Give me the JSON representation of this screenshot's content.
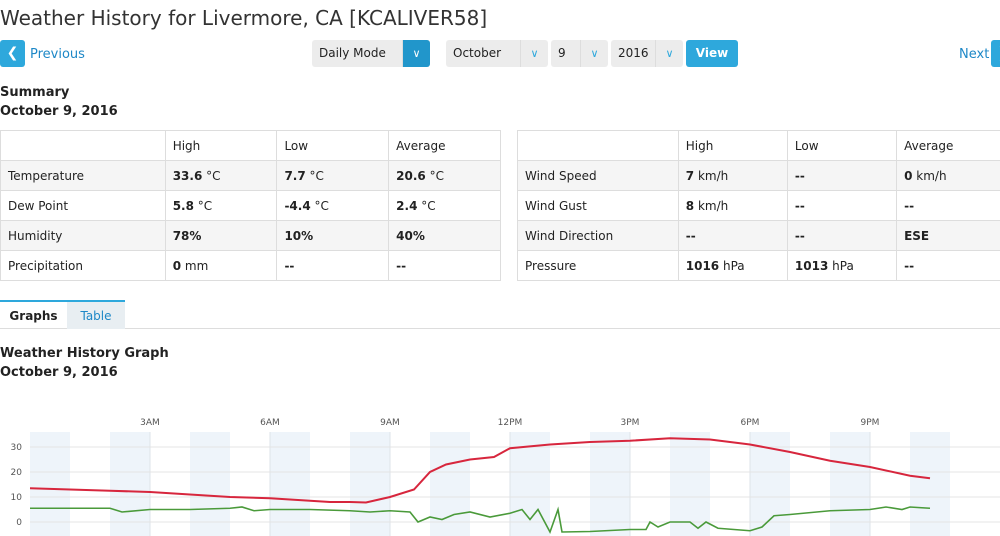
{
  "title": "Weather History for Livermore, CA [KCALIVER58]",
  "nav": {
    "previous": "Previous",
    "next": "Next",
    "mode": "Daily Mode",
    "month": "October",
    "day": "9",
    "year": "2016",
    "view": "View"
  },
  "summary": {
    "heading": "Summary",
    "date": "October 9, 2016",
    "left": {
      "headers": [
        "",
        "High",
        "Low",
        "Average"
      ],
      "rows": [
        [
          "Temperature",
          "33.6",
          "°C",
          "7.7",
          "°C",
          "20.6",
          "°C"
        ],
        [
          "Dew Point",
          "5.8",
          "°C",
          "-4.4",
          "°C",
          "2.4",
          "°C"
        ],
        [
          "Humidity",
          "78%",
          "",
          "10%",
          "",
          "40%",
          ""
        ],
        [
          "Precipitation",
          "0",
          "mm",
          "--",
          "",
          "--",
          ""
        ]
      ]
    },
    "right": {
      "headers": [
        "",
        "High",
        "Low",
        "Average"
      ],
      "rows": [
        [
          "Wind Speed",
          "7",
          "km/h",
          "--",
          "",
          "0",
          "km/h"
        ],
        [
          "Wind Gust",
          "8",
          "km/h",
          "--",
          "",
          "--",
          ""
        ],
        [
          "Wind Direction",
          "--",
          "",
          "--",
          "",
          "ESE",
          ""
        ],
        [
          "Pressure",
          "1016",
          "hPa",
          "1013",
          "hPa",
          "--",
          ""
        ]
      ]
    }
  },
  "tabs": [
    {
      "label": "Graphs",
      "active": true
    },
    {
      "label": "Table",
      "active": false
    }
  ],
  "graph": {
    "heading": "Weather History Graph",
    "date": "October 9, 2016"
  },
  "chart_data": {
    "type": "line",
    "x_unit": "hour of day",
    "xticks": [
      {
        "h": 3,
        "label": "3AM"
      },
      {
        "h": 6,
        "label": "6AM"
      },
      {
        "h": 9,
        "label": "9AM"
      },
      {
        "h": 12,
        "label": "12PM"
      },
      {
        "h": 15,
        "label": "3PM"
      },
      {
        "h": 18,
        "label": "6PM"
      },
      {
        "h": 21,
        "label": "9PM"
      }
    ],
    "yticks": [
      0,
      10,
      20,
      30
    ],
    "ylim": [
      -6,
      36
    ],
    "xlim": [
      0,
      24
    ],
    "series": [
      {
        "color": "#d7263d",
        "points": [
          [
            0,
            13.5
          ],
          [
            1,
            13
          ],
          [
            2,
            12.5
          ],
          [
            3,
            12
          ],
          [
            4,
            11
          ],
          [
            5,
            10
          ],
          [
            6,
            9.5
          ],
          [
            7,
            8.5
          ],
          [
            7.5,
            8
          ],
          [
            8,
            8
          ],
          [
            8.4,
            7.8
          ],
          [
            9,
            10
          ],
          [
            9.6,
            13
          ],
          [
            10,
            20
          ],
          [
            10.4,
            23
          ],
          [
            11,
            25
          ],
          [
            11.6,
            26
          ],
          [
            12,
            29.5
          ],
          [
            13,
            31
          ],
          [
            14,
            32
          ],
          [
            15,
            32.5
          ],
          [
            16,
            33.5
          ],
          [
            17,
            33
          ],
          [
            18,
            31
          ],
          [
            19,
            28
          ],
          [
            20,
            24.5
          ],
          [
            21,
            22
          ],
          [
            22,
            18.5
          ],
          [
            22.5,
            17.5
          ]
        ]
      },
      {
        "color": "#4a9a3a",
        "points": [
          [
            0,
            5.5
          ],
          [
            1,
            5.5
          ],
          [
            2,
            5.5
          ],
          [
            2.3,
            4
          ],
          [
            3,
            5
          ],
          [
            4,
            5
          ],
          [
            5,
            5.5
          ],
          [
            5.3,
            6
          ],
          [
            5.6,
            4.5
          ],
          [
            6,
            5
          ],
          [
            7,
            5
          ],
          [
            8,
            4.5
          ],
          [
            8.5,
            4
          ],
          [
            9,
            4.5
          ],
          [
            9.5,
            4
          ],
          [
            9.7,
            0
          ],
          [
            10,
            2
          ],
          [
            10.3,
            1
          ],
          [
            10.6,
            3
          ],
          [
            11,
            4
          ],
          [
            11.5,
            2
          ],
          [
            12,
            3.5
          ],
          [
            12.3,
            5
          ],
          [
            12.5,
            1
          ],
          [
            12.7,
            5
          ],
          [
            13,
            -4
          ],
          [
            13.2,
            5
          ],
          [
            13.3,
            -4
          ],
          [
            14,
            -3.8
          ],
          [
            15,
            -3
          ],
          [
            15.4,
            -3
          ],
          [
            15.5,
            0
          ],
          [
            15.7,
            -2
          ],
          [
            16,
            0
          ],
          [
            16.5,
            0
          ],
          [
            16.7,
            -2.5
          ],
          [
            16.9,
            0
          ],
          [
            17.2,
            -2.5
          ],
          [
            18,
            -3.5
          ],
          [
            18.3,
            -2
          ],
          [
            18.6,
            2.5
          ],
          [
            19,
            3
          ],
          [
            20,
            4.5
          ],
          [
            21,
            5
          ],
          [
            21.4,
            6
          ],
          [
            21.8,
            5
          ],
          [
            22,
            6
          ],
          [
            22.5,
            5.5
          ]
        ]
      }
    ]
  }
}
